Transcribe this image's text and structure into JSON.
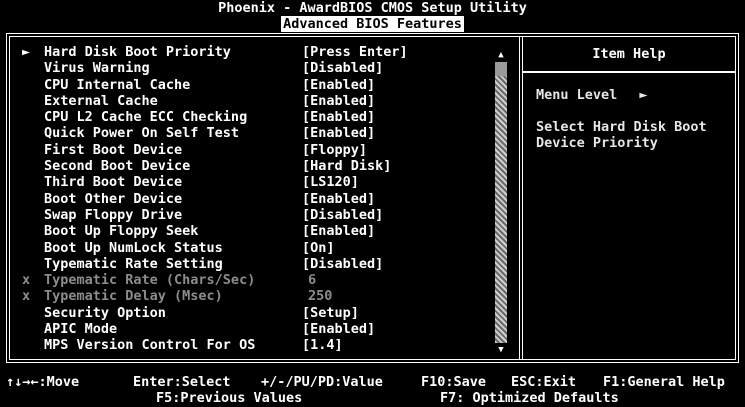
{
  "header": {
    "title": "Phoenix - AwardBIOS CMOS Setup Utility",
    "subtitle": "Advanced BIOS Features"
  },
  "settings": [
    {
      "marker": "►",
      "label": "Hard Disk Boot Priority",
      "value": "[Press Enter]",
      "disabled": false
    },
    {
      "marker": "",
      "label": "Virus Warning",
      "value": "[Disabled]",
      "disabled": false
    },
    {
      "marker": "",
      "label": "CPU Internal Cache",
      "value": "[Enabled]",
      "disabled": false
    },
    {
      "marker": "",
      "label": "External Cache",
      "value": "[Enabled]",
      "disabled": false
    },
    {
      "marker": "",
      "label": "CPU L2 Cache ECC Checking",
      "value": "[Enabled]",
      "disabled": false
    },
    {
      "marker": "",
      "label": "Quick Power On Self Test",
      "value": "[Enabled]",
      "disabled": false
    },
    {
      "marker": "",
      "label": "First Boot Device",
      "value": "[Floppy]",
      "disabled": false
    },
    {
      "marker": "",
      "label": "Second Boot Device",
      "value": "[Hard Disk]",
      "disabled": false
    },
    {
      "marker": "",
      "label": "Third Boot Device",
      "value": "[LS120]",
      "disabled": false
    },
    {
      "marker": "",
      "label": "Boot Other Device",
      "value": "[Enabled]",
      "disabled": false
    },
    {
      "marker": "",
      "label": "Swap Floppy Drive",
      "value": "[Disabled]",
      "disabled": false
    },
    {
      "marker": "",
      "label": "Boot Up Floppy Seek",
      "value": "[Enabled]",
      "disabled": false
    },
    {
      "marker": "",
      "label": "Boot Up NumLock Status",
      "value": "[On]",
      "disabled": false
    },
    {
      "marker": "",
      "label": "Typematic Rate Setting",
      "value": "[Disabled]",
      "disabled": false
    },
    {
      "marker": "x",
      "label": "Typematic Rate (Chars/Sec)",
      "value": "6",
      "disabled": true
    },
    {
      "marker": "x",
      "label": "Typematic Delay (Msec)",
      "value": "250",
      "disabled": true
    },
    {
      "marker": "",
      "label": "Security Option",
      "value": "[Setup]",
      "disabled": false
    },
    {
      "marker": "",
      "label": "APIC Mode",
      "value": "[Enabled]",
      "disabled": false
    },
    {
      "marker": "",
      "label": "MPS Version Control For OS",
      "value": "[1.4]",
      "disabled": false
    }
  ],
  "scrollbar": {
    "up_glyph": "▲",
    "down_glyph": "▼",
    "thumb_start_fraction": 0.05,
    "thumb_end_fraction": 1.0
  },
  "help": {
    "title": "Item Help",
    "menu_level_label": "Menu Level",
    "menu_level_glyph": "►",
    "lines": [
      "Select Hard Disk Boot",
      "Device Priority"
    ]
  },
  "footer": {
    "move": "↑↓→←:Move",
    "select": "Enter:Select",
    "value": "+/-/PU/PD:Value",
    "save": "F10:Save",
    "exit": "ESC:Exit",
    "help": "F1:General Help",
    "previous": "F5:Previous Values",
    "defaults": "F7: Optimized Defaults"
  },
  "colors": {
    "background": "#000000",
    "text": "#ffffff",
    "disabled_text": "#8c8c8c",
    "subtitle_bg": "#ffffff",
    "subtitle_text": "#000000"
  }
}
